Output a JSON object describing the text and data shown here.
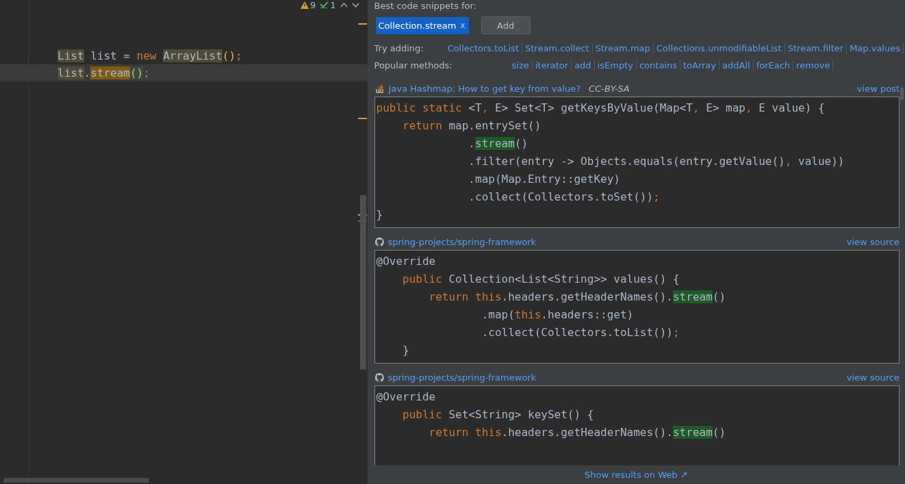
{
  "editor": {
    "inspections": {
      "warnings": "9",
      "weak_warnings": "1"
    },
    "lines": [
      {
        "current": false,
        "tokens": [
          {
            "text": "List",
            "kind": "typeref"
          },
          {
            "text": " list = ",
            "kind": "plain"
          },
          {
            "text": "new ",
            "kind": "keyword"
          },
          {
            "text": "ArrayList",
            "kind": "typeref"
          },
          {
            "text": "()",
            "kind": "paren"
          },
          {
            "text": ";",
            "kind": "keyword"
          }
        ]
      },
      {
        "current": true,
        "tokens": [
          {
            "text": "list",
            "kind": "typeref"
          },
          {
            "text": ".",
            "kind": "plain"
          },
          {
            "text": "stream",
            "kind": "method"
          },
          {
            "text": "()",
            "kind": "parenmatch"
          },
          {
            "text": ";",
            "kind": "keyword"
          }
        ]
      }
    ]
  },
  "snippets_panel": {
    "heading": "Best code snippets for:",
    "query_tag": {
      "label": "Collection.stream",
      "remove": "x"
    },
    "add_button": "Add",
    "suggestion_rows": [
      {
        "label": "Try adding:",
        "items": [
          "Collectors.toList",
          "Stream.collect",
          "Stream.map",
          "Collections.unmodifiableList",
          "Stream.filter",
          "Map.values"
        ]
      },
      {
        "label": "Popular methods:",
        "items": [
          "size",
          "iterator",
          "add",
          "isEmpty",
          "contains",
          "toArray",
          "addAll",
          "forEach",
          "remove"
        ]
      }
    ],
    "results": [
      {
        "kind": "post",
        "title": "Java Hashmap: How to get key from value?",
        "license": "CC-BY-SA",
        "action": "view post",
        "code": [
          [
            {
              "text": "public static",
              "kind": "keyword"
            },
            {
              "text": " <T",
              "kind": "plain"
            },
            {
              "text": ",",
              "kind": "keyword"
            },
            {
              "text": " E> Set<T> getKeysByValue(Map<T",
              "kind": "plain"
            },
            {
              "text": ",",
              "kind": "keyword"
            },
            {
              "text": " E> map",
              "kind": "plain"
            },
            {
              "text": ",",
              "kind": "keyword"
            },
            {
              "text": " E value) {",
              "kind": "plain"
            }
          ],
          [
            {
              "text": "    return",
              "kind": "keyword"
            },
            {
              "text": " map.entrySet()",
              "kind": "plain"
            }
          ],
          [
            {
              "text": "              .",
              "kind": "plain"
            },
            {
              "text": "stream",
              "kind": "highlight"
            },
            {
              "text": "()",
              "kind": "plain"
            }
          ],
          [
            {
              "text": "              .filter(entry -> Objects.equals(entry.getValue()",
              "kind": "plain"
            },
            {
              "text": ",",
              "kind": "keyword"
            },
            {
              "text": " value))",
              "kind": "plain"
            }
          ],
          [
            {
              "text": "              .map(Map.Entry::getKey)",
              "kind": "plain"
            }
          ],
          [
            {
              "text": "              .collect(Collectors.toSet())",
              "kind": "plain"
            },
            {
              "text": ";",
              "kind": "keyword"
            }
          ],
          [
            {
              "text": "}",
              "kind": "plain"
            }
          ]
        ]
      },
      {
        "kind": "repo",
        "title": "spring-projects/spring-framework",
        "action": "view source",
        "code": [
          [
            {
              "text": "@Override",
              "kind": "plain"
            }
          ],
          [
            {
              "text": "    public",
              "kind": "keyword"
            },
            {
              "text": " Collection<List<String>> values() {",
              "kind": "plain"
            }
          ],
          [
            {
              "text": "        return this",
              "kind": "keyword"
            },
            {
              "text": ".headers.getHeaderNames().",
              "kind": "plain"
            },
            {
              "text": "stream",
              "kind": "highlight"
            },
            {
              "text": "()",
              "kind": "plain"
            }
          ],
          [
            {
              "text": "                .map(",
              "kind": "plain"
            },
            {
              "text": "this",
              "kind": "keyword"
            },
            {
              "text": ".headers::get)",
              "kind": "plain"
            }
          ],
          [
            {
              "text": "                .collect(Collectors.toList())",
              "kind": "plain"
            },
            {
              "text": ";",
              "kind": "keyword"
            }
          ],
          [
            {
              "text": "    }",
              "kind": "plain"
            }
          ]
        ]
      },
      {
        "kind": "repo",
        "title": "spring-projects/spring-framework",
        "action": "view source",
        "code": [
          [
            {
              "text": "@Override",
              "kind": "plain"
            }
          ],
          [
            {
              "text": "    public",
              "kind": "keyword"
            },
            {
              "text": " Set<String> keySet() {",
              "kind": "plain"
            }
          ],
          [
            {
              "text": "        return this",
              "kind": "keyword"
            },
            {
              "text": ".headers.getHeaderNames().",
              "kind": "plain"
            },
            {
              "text": "stream",
              "kind": "highlight"
            },
            {
              "text": "()",
              "kind": "plain"
            }
          ]
        ]
      }
    ],
    "footer_link": "Show results on Web ↗"
  }
}
